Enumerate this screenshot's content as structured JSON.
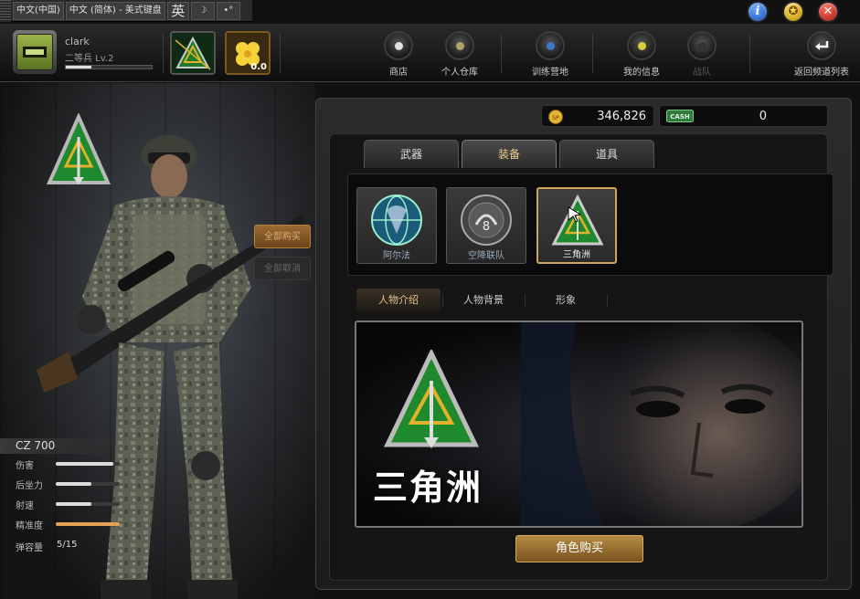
{
  "ime": {
    "lang_cn": "中文(中国)",
    "keyboard": "中文 (简体) - 美式键盘",
    "mode": "英",
    "moon": "☽",
    "punct": "•°"
  },
  "window_buttons": {
    "info": "i",
    "star": "✪",
    "close": "✕"
  },
  "player": {
    "name": "clark",
    "rank": "二等兵 Lv.2",
    "xp_progress": 0.3
  },
  "coin_slot": {
    "value": "0.0"
  },
  "nav": [
    {
      "label": "商店",
      "color": "#e0e0e0",
      "enabled": true
    },
    {
      "label": "个人仓库",
      "color": "#b7a16a",
      "enabled": true
    },
    {
      "label": "训练营地",
      "color": "#3f78c8",
      "enabled": true
    },
    {
      "label": "我的信息",
      "color": "#d9cf3a",
      "enabled": true
    },
    {
      "label": "战队",
      "color": "#333333",
      "enabled": false
    },
    {
      "label": "返回频道列表",
      "color": "#ffffff",
      "enabled": true
    }
  ],
  "side_buttons": {
    "buy_all": "全部购买",
    "cancel_all": "全部取消"
  },
  "weapon": {
    "name": "CZ 700",
    "stats": [
      {
        "label": "伤害",
        "level": 0.9,
        "highlight": false
      },
      {
        "label": "后坐力",
        "level": 0.55,
        "highlight": false
      },
      {
        "label": "射速",
        "level": 0.55,
        "highlight": false
      },
      {
        "label": "精准度",
        "level": 1.0,
        "highlight": true
      }
    ],
    "ammo_label": "弹容量",
    "ammo_value": "5/15"
  },
  "currency": {
    "sp_icon": "SP",
    "sp_value": "346,826",
    "cash_icon": "CASH",
    "cash_value": "0"
  },
  "tabs": [
    {
      "label": "武器",
      "active": false
    },
    {
      "label": "装备",
      "active": true
    },
    {
      "label": "道具",
      "active": false
    }
  ],
  "cards": [
    {
      "label": "阿尔法",
      "selected": false
    },
    {
      "label": "空降联队",
      "selected": false
    },
    {
      "label": "三角洲",
      "selected": true
    }
  ],
  "subtabs": [
    {
      "label": "人物介绍",
      "active": true
    },
    {
      "label": "人物背景",
      "active": false
    },
    {
      "label": "形象",
      "active": false
    }
  ],
  "viewer": {
    "name": "三角洲"
  },
  "buy_button": "角色购买",
  "colors": {
    "accent": "#d0a55a",
    "panel": "#1c1c1c"
  }
}
